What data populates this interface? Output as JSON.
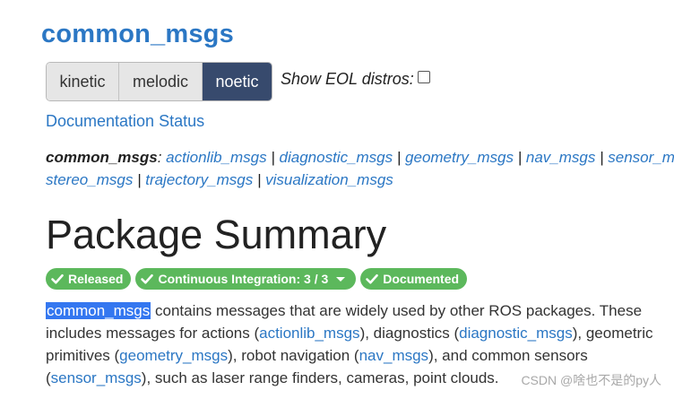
{
  "title": "common_msgs",
  "distros": {
    "buttons": [
      "kinetic",
      "melodic",
      "noetic"
    ],
    "selected": "noetic",
    "show_eol_label": "Show EOL distros:",
    "show_eol_checked": false
  },
  "documentation_status": "Documentation Status",
  "package_links": {
    "parent": "common_msgs",
    "colon": ":",
    "line1": [
      "actionlib_msgs",
      "diagnostic_msgs",
      "geometry_msgs",
      "nav_msgs",
      "sensor_msgs"
    ],
    "line2": [
      "stereo_msgs",
      "trajectory_msgs",
      "visualization_msgs"
    ],
    "separator": "|"
  },
  "summary_heading": "Package Summary",
  "badges": {
    "released": "Released",
    "ci": "Continuous Integration: 3 / 3",
    "documented": "Documented"
  },
  "description": {
    "l1_link": "common_msgs",
    "l1_text": " contains messages that are widely used by other ROS packages. These",
    "l2_a": "includes messages for actions (",
    "l2_link1": "actionlib_msgs",
    "l2_b": "), diagnostics (",
    "l2_link2": "diagnostic_msgs",
    "l2_c": "), geometric",
    "l3_a": "primitives (",
    "l3_link1": "geometry_msgs",
    "l3_b": "), robot navigation (",
    "l3_link2": "nav_msgs",
    "l3_c": "), and common sensors",
    "l4_a": "(",
    "l4_link": "sensor_msgs",
    "l4_b": "), such as laser range finders, cameras, point clouds."
  },
  "watermark": "CSDN @啥也不是的py人",
  "colors": {
    "link": "#2b77c4",
    "distro_active": "#374a6d",
    "badge": "#5cb85c",
    "selection": "#3477f0"
  }
}
